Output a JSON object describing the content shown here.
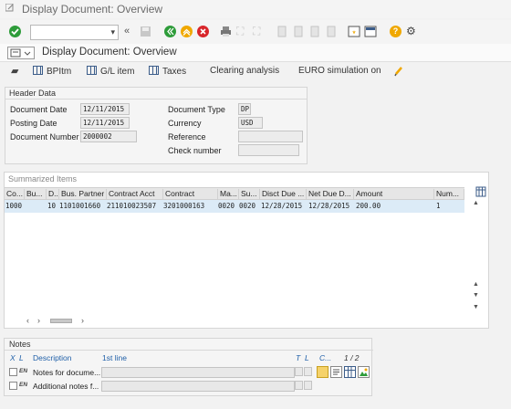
{
  "window": {
    "title": "Display Document: Overview"
  },
  "toolbar": {
    "command_field_value": "",
    "icons": [
      "enter-icon",
      "back-icon",
      "exit-icon",
      "cancel-icon",
      "print-icon",
      "find-icon",
      "find-next-icon",
      "first-page-icon",
      "previous-page-icon",
      "next-page-icon",
      "last-page-icon",
      "create-session-icon",
      "shortcut-icon",
      "help-icon",
      "settings-icon"
    ],
    "colors": {
      "green": "#2e9c3a",
      "yellow": "#f0a800",
      "red": "#d8262b",
      "help": "#f0a800"
    }
  },
  "subtitle": "Display Document: Overview",
  "app_toolbar": {
    "items": [
      {
        "label": "",
        "icon": "hat-icon"
      },
      {
        "label": "BPItm",
        "icon": "grid-icon"
      },
      {
        "label": "G/L item",
        "icon": "grid-icon"
      },
      {
        "label": "Taxes",
        "icon": "grid-icon"
      },
      {
        "label": "Clearing analysis",
        "icon": ""
      },
      {
        "label": "EURO simulation on",
        "icon": ""
      },
      {
        "label": "",
        "icon": "edit-icon"
      }
    ]
  },
  "header_data": {
    "title": "Header Data",
    "document_date": {
      "label": "Document Date",
      "value": "12/11/2015"
    },
    "posting_date": {
      "label": "Posting Date",
      "value": "12/11/2015"
    },
    "document_number": {
      "label": "Document Number",
      "value": "2000002"
    },
    "document_type": {
      "label": "Document Type",
      "value": "DP"
    },
    "currency": {
      "label": "Currency",
      "value": "USD"
    },
    "reference": {
      "label": "Reference",
      "value": ""
    },
    "check_number": {
      "label": "Check number",
      "value": ""
    }
  },
  "summarized_items": {
    "title": "Summarized Items",
    "columns": [
      "Co...",
      "Bu...",
      "D...",
      "Bus. Partner",
      "Contract Acct",
      "Contract",
      "Ma...",
      "Su...",
      "Disct Due ...",
      "Net Due D...",
      "Amount",
      "Num..."
    ],
    "rows": [
      [
        "1000",
        "",
        "10",
        "1101001660",
        "211010023507",
        "3201000163",
        "0020",
        "0020",
        "12/28/2015",
        "12/28/2015",
        "200.00",
        "1"
      ]
    ]
  },
  "notes": {
    "title": "Notes",
    "header": {
      "x": "X",
      "l": "L",
      "description": "Description",
      "first_line": "1st line",
      "t": "T",
      "l2": "L",
      "c": "C...",
      "page": "1 / 2"
    },
    "rows": [
      {
        "lang": "EN",
        "description": "Notes for docume...",
        "first_line": ""
      },
      {
        "lang": "EN",
        "description": "Additional notes f...",
        "first_line": ""
      }
    ]
  }
}
